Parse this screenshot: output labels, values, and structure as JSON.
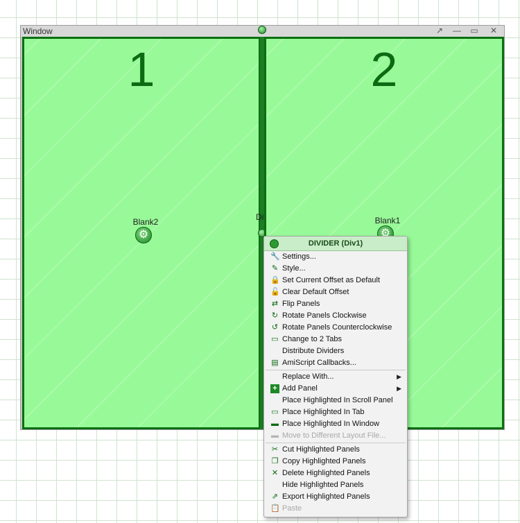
{
  "window": {
    "title": "Window"
  },
  "panels": [
    {
      "number": "1",
      "blank_label": "Blank2"
    },
    {
      "number": "2",
      "blank_label": "Blank1"
    }
  ],
  "divider": {
    "label": "Div1"
  },
  "context_menu": {
    "title": "DIVIDER (Div1)",
    "items": [
      {
        "label": "Settings...",
        "icon": "wrench-icon"
      },
      {
        "label": "Style...",
        "icon": "brush-icon"
      },
      {
        "label": "Set Current Offset as Default",
        "icon": "lock-icon"
      },
      {
        "label": "Clear Default Offset",
        "icon": "unlock-icon"
      },
      {
        "label": "Flip Panels",
        "icon": "flip-icon"
      },
      {
        "label": "Rotate Panels Clockwise",
        "icon": "rotate-cw-icon"
      },
      {
        "label": "Rotate Panels Counterclockwise",
        "icon": "rotate-ccw-icon"
      },
      {
        "label": "Change to 2 Tabs",
        "icon": "tabs-icon"
      },
      {
        "label": "Distribute Dividers",
        "icon": ""
      },
      {
        "label": "AmiScript Callbacks...",
        "icon": "script-icon"
      },
      {
        "label": "Replace With...",
        "icon": ""
      },
      {
        "label": "Add Panel",
        "icon": "plus-icon"
      },
      {
        "label": "Place Highlighted In Scroll Panel",
        "icon": ""
      },
      {
        "label": "Place Highlighted In Tab",
        "icon": "tab-icon"
      },
      {
        "label": "Place Highlighted In Window",
        "icon": "window-icon"
      },
      {
        "label": "Move to Different Layout File...",
        "icon": "move-icon"
      },
      {
        "label": "Cut Highlighted Panels",
        "icon": "scissors-icon"
      },
      {
        "label": "Copy Highlighted Panels",
        "icon": "copy-icon"
      },
      {
        "label": "Delete Highlighted Panels",
        "icon": "x-icon"
      },
      {
        "label": "Hide Highlighted Panels",
        "icon": ""
      },
      {
        "label": "Export Highlighted Panels",
        "icon": "export-icon"
      },
      {
        "label": "Paste",
        "icon": "paste-icon"
      }
    ]
  },
  "colors": {
    "panel_fill": "#98f998",
    "panel_border": "#0b6f12",
    "divider": "#1c7d24",
    "menu_header": "#c9ecc9"
  }
}
